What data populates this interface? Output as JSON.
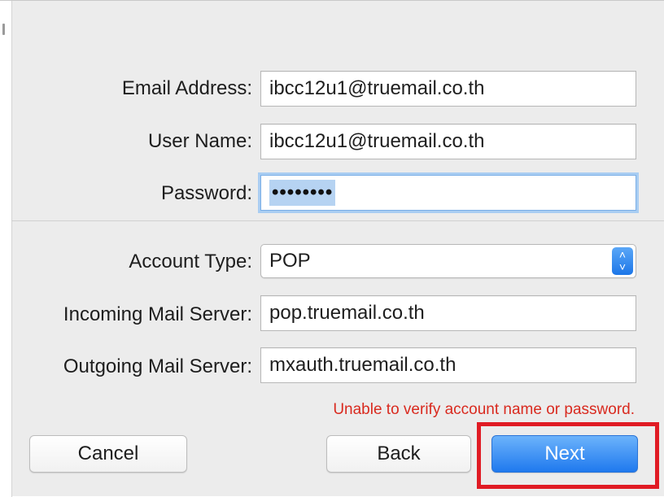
{
  "form": {
    "email_label": "Email Address:",
    "email_value": "ibcc12u1@truemail.co.th",
    "username_label": "User Name:",
    "username_value": "ibcc12u1@truemail.co.th",
    "password_label": "Password:",
    "password_value": "••••••••",
    "account_type_label": "Account Type:",
    "account_type_value": "POP",
    "incoming_label": "Incoming Mail Server:",
    "incoming_value": "pop.truemail.co.th",
    "outgoing_label": "Outgoing Mail Server:",
    "outgoing_value": "mxauth.truemail.co.th"
  },
  "error_message": "Unable to verify account name or password.",
  "buttons": {
    "cancel": "Cancel",
    "back": "Back",
    "next": "Next"
  },
  "colors": {
    "accent": "#1f79ee",
    "error": "#d92a1f",
    "highlight": "#e01b24"
  }
}
